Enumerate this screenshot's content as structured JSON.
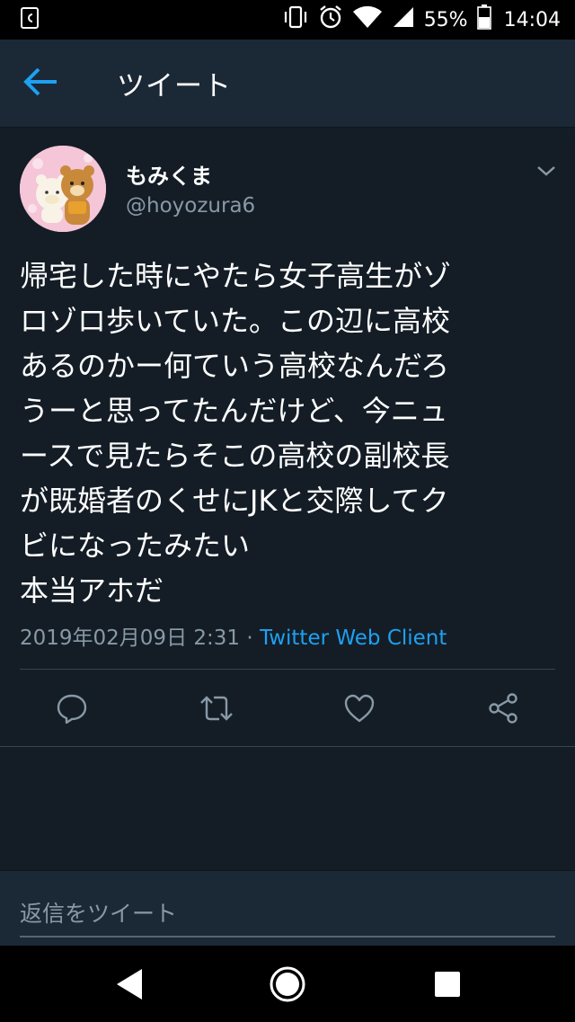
{
  "status_bar": {
    "battery_percent": "55%",
    "time": "14:04",
    "icons": [
      "app-notification-icon",
      "vibrate-icon",
      "alarm-icon",
      "wifi-icon",
      "signal-icon",
      "battery-icon"
    ]
  },
  "header": {
    "title": "ツイート",
    "back_icon": "back-arrow-icon"
  },
  "tweet": {
    "display_name": "もみくま",
    "handle": "@hoyozura6",
    "text": "帰宅した時にやたら女子高生がゾロゾロ歩いていた。この辺に高校あるのかー何ていう高校なんだろうーと思ってたんだけど、今ニュースで見たらそこの高校の副校長が既婚者のくせにJKと交際してクビになったみたい\n本当アホだ",
    "text_lines": [
      "帰宅した時にやたら女子高生がゾ",
      "ロゾロ歩いていた。この辺に高校",
      "あるのかー何ていう高校なんだろ",
      "うーと思ってたんだけど、今ニュ",
      "ースで見たらそこの高校の副校長",
      "が既婚者のくせにJKと交際してク",
      "ビになったみたい",
      "本当アホだ"
    ],
    "timestamp": "2019年02月09日 2:31",
    "separator": " · ",
    "client": "Twitter Web Client",
    "actions": [
      "reply-icon",
      "retweet-icon",
      "like-icon",
      "share-icon"
    ]
  },
  "reply": {
    "placeholder": "返信をツイート"
  },
  "colors": {
    "background": "#141d26",
    "header_bg": "#1b2836",
    "accent": "#1da1f2",
    "secondary_text": "#8899a6"
  }
}
